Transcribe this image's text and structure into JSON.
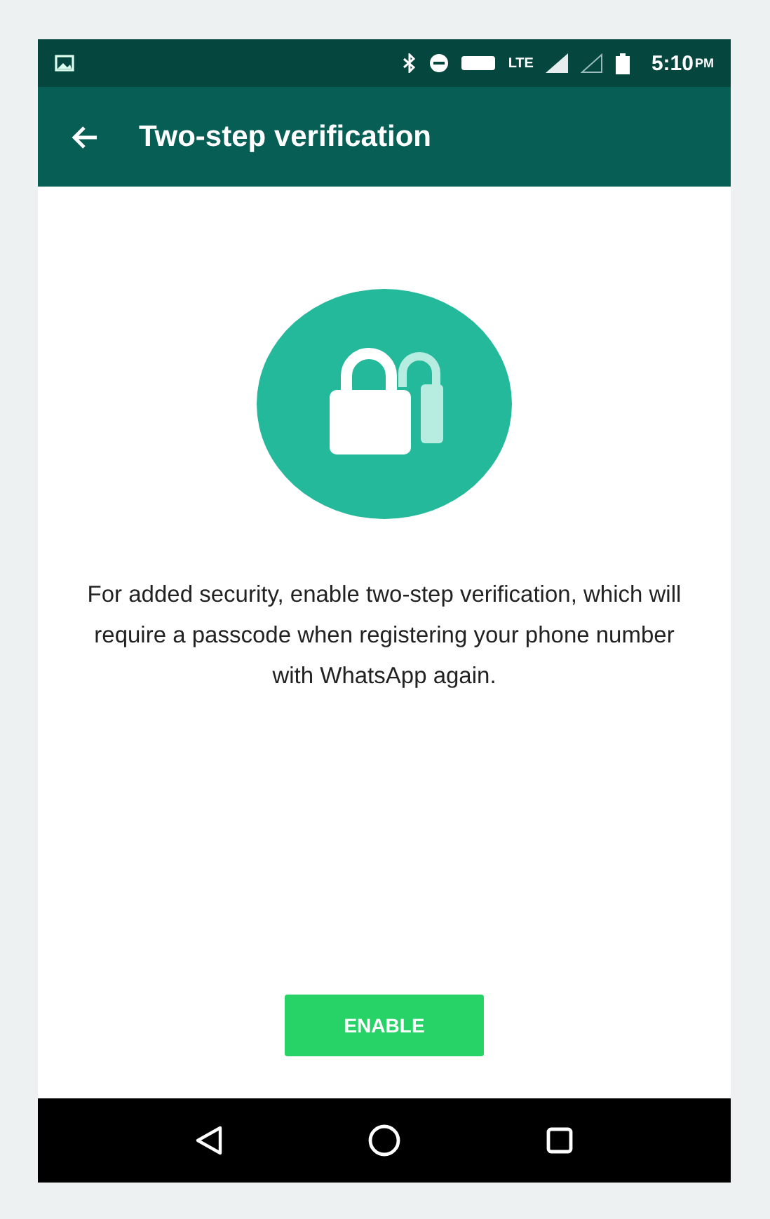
{
  "status_bar": {
    "time": "5:10",
    "time_suffix": "PM",
    "network": "LTE"
  },
  "toolbar": {
    "title": "Two-step verification"
  },
  "description": "For added security, enable two-step verification, which will require a passcode when registering your phone number with WhatsApp again.",
  "buttons": [
    {
      "label": "ENABLE",
      "kind": "primary"
    }
  ]
}
